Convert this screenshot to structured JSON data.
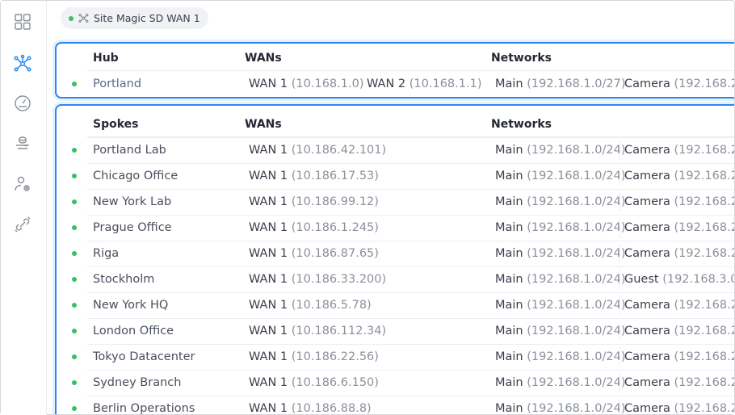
{
  "breadcrumb": {
    "label": "Site Magic SD WAN 1",
    "status_color": "#38c15f"
  },
  "sidebar": {
    "items": [
      {
        "icon": "grid-icon",
        "active": false
      },
      {
        "icon": "topology-icon",
        "active": true
      },
      {
        "icon": "speedometer-icon",
        "active": false
      },
      {
        "icon": "device-stack-icon",
        "active": false
      },
      {
        "icon": "user-settings-icon",
        "active": false
      },
      {
        "icon": "link-icon",
        "active": false
      }
    ]
  },
  "hub": {
    "headers": {
      "name": "Hub",
      "wans": "WANs",
      "networks": "Networks"
    },
    "row": {
      "name": "Portland",
      "wan1_label": "WAN 1",
      "wan1_ip": "(10.168.1.0)",
      "wan2_label": "WAN 2",
      "wan2_ip": "(10.168.1.1)",
      "net1_label": "Main",
      "net1_ip": "(192.168.1.0/27)",
      "net2_label": "Camera",
      "net2_ip": "(192.168.2.0"
    }
  },
  "spokes": {
    "headers": {
      "name": "Spokes",
      "wans": "WANs",
      "networks": "Networks"
    },
    "rows": [
      {
        "name": "Portland Lab",
        "wan_label": "WAN 1",
        "wan_ip": "(10.186.42.101)",
        "net1_label": "Main",
        "net1_ip": "(192.168.1.0/24)",
        "net2_label": "Camera",
        "net2_ip": "(192.168.2.0"
      },
      {
        "name": "Chicago Office",
        "wan_label": "WAN 1",
        "wan_ip": "(10.186.17.53)",
        "net1_label": "Main",
        "net1_ip": "(192.168.1.0/24)",
        "net2_label": "Camera",
        "net2_ip": "(192.168.2.0"
      },
      {
        "name": "New York Lab",
        "wan_label": "WAN 1",
        "wan_ip": "(10.186.99.12)",
        "net1_label": "Main",
        "net1_ip": "(192.168.1.0/24)",
        "net2_label": "Camera",
        "net2_ip": "(192.168.2.0"
      },
      {
        "name": "Prague Office",
        "wan_label": "WAN 1",
        "wan_ip": "(10.186.1.245)",
        "net1_label": "Main",
        "net1_ip": "(192.168.1.0/24)",
        "net2_label": "Camera",
        "net2_ip": "(192.168.2.0"
      },
      {
        "name": "Riga",
        "wan_label": "WAN 1",
        "wan_ip": "(10.186.87.65)",
        "net1_label": "Main",
        "net1_ip": "(192.168.1.0/24)",
        "net2_label": "Camera",
        "net2_ip": "(192.168.2.0"
      },
      {
        "name": "Stockholm",
        "wan_label": "WAN 1",
        "wan_ip": "(10.186.33.200)",
        "net1_label": "Main",
        "net1_ip": "(192.168.1.0/24)",
        "net2_label": "Guest",
        "net2_ip": "(192.168.3.0/"
      },
      {
        "name": "New York HQ",
        "wan_label": "WAN 1",
        "wan_ip": "(10.186.5.78)",
        "net1_label": "Main",
        "net1_ip": "(192.168.1.0/24)",
        "net2_label": "Camera",
        "net2_ip": "(192.168.2.0"
      },
      {
        "name": "London Office",
        "wan_label": "WAN 1",
        "wan_ip": "(10.186.112.34)",
        "net1_label": "Main",
        "net1_ip": "(192.168.1.0/24)",
        "net2_label": "Camera",
        "net2_ip": "(192.168.2.0"
      },
      {
        "name": "Tokyo Datacenter",
        "wan_label": "WAN 1",
        "wan_ip": "(10.186.22.56)",
        "net1_label": "Main",
        "net1_ip": "(192.168.1.0/24)",
        "net2_label": "Camera",
        "net2_ip": "(192.168.2.0"
      },
      {
        "name": "Sydney Branch",
        "wan_label": "WAN 1",
        "wan_ip": "(10.186.6.150)",
        "net1_label": "Main",
        "net1_ip": "(192.168.1.0/24)",
        "net2_label": "Camera",
        "net2_ip": "(192.168.2.0"
      },
      {
        "name": "Berlin Operations",
        "wan_label": "WAN 1",
        "wan_ip": "(10.186.88.8)",
        "net1_label": "Main",
        "net1_ip": "(192.168.1.0/24)",
        "net2_label": "Camera",
        "net2_ip": "(192.168.2.0"
      }
    ]
  },
  "colors": {
    "accent": "#2b86f0",
    "online": "#38c15f",
    "ip_text": "#8b909c"
  }
}
